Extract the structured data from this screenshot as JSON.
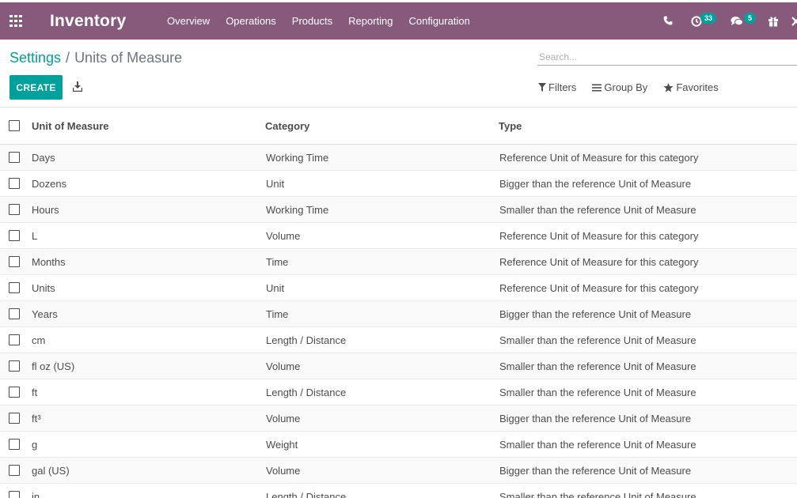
{
  "app": {
    "name": "Inventory",
    "menu": [
      "Overview",
      "Operations",
      "Products",
      "Reporting",
      "Configuration"
    ]
  },
  "systray": {
    "activity_count": "33",
    "messages_count": "5"
  },
  "breadcrumb": {
    "parent": "Settings",
    "separator": "/",
    "current": "Units of Measure"
  },
  "search": {
    "placeholder": "Search..."
  },
  "toolbar": {
    "create_label": "CREATE",
    "filters_label": "Filters",
    "groupby_label": "Group By",
    "favorites_label": "Favorites"
  },
  "table": {
    "headers": [
      "Unit of Measure",
      "Category",
      "Type"
    ],
    "rows": [
      [
        "Days",
        "Working Time",
        "Reference Unit of Measure for this category"
      ],
      [
        "Dozens",
        "Unit",
        "Bigger than the reference Unit of Measure"
      ],
      [
        "Hours",
        "Working Time",
        "Smaller than the reference Unit of Measure"
      ],
      [
        "L",
        "Volume",
        "Reference Unit of Measure for this category"
      ],
      [
        "Months",
        "Time",
        "Reference Unit of Measure for this category"
      ],
      [
        "Units",
        "Unit",
        "Reference Unit of Measure for this category"
      ],
      [
        "Years",
        "Time",
        "Bigger than the reference Unit of Measure"
      ],
      [
        "cm",
        "Length / Distance",
        "Smaller than the reference Unit of Measure"
      ],
      [
        "fl oz (US)",
        "Volume",
        "Smaller than the reference Unit of Measure"
      ],
      [
        "ft",
        "Length / Distance",
        "Smaller than the reference Unit of Measure"
      ],
      [
        "ft³",
        "Volume",
        "Bigger than the reference Unit of Measure"
      ],
      [
        "g",
        "Weight",
        "Smaller than the reference Unit of Measure"
      ],
      [
        "gal (US)",
        "Volume",
        "Bigger than the reference Unit of Measure"
      ],
      [
        "in",
        "Length / Distance",
        "Smaller than the reference Unit of Measure"
      ]
    ]
  },
  "colors": {
    "navbar": "#875a7b",
    "primary": "#00a09d",
    "badge": "#00a09d"
  },
  "icons": [
    "apps-grid-icon",
    "phone-icon",
    "activity-clock-icon",
    "chat-icon",
    "gift-icon",
    "debug-icon",
    "download-icon",
    "filter-icon",
    "group-by-icon",
    "star-icon"
  ]
}
